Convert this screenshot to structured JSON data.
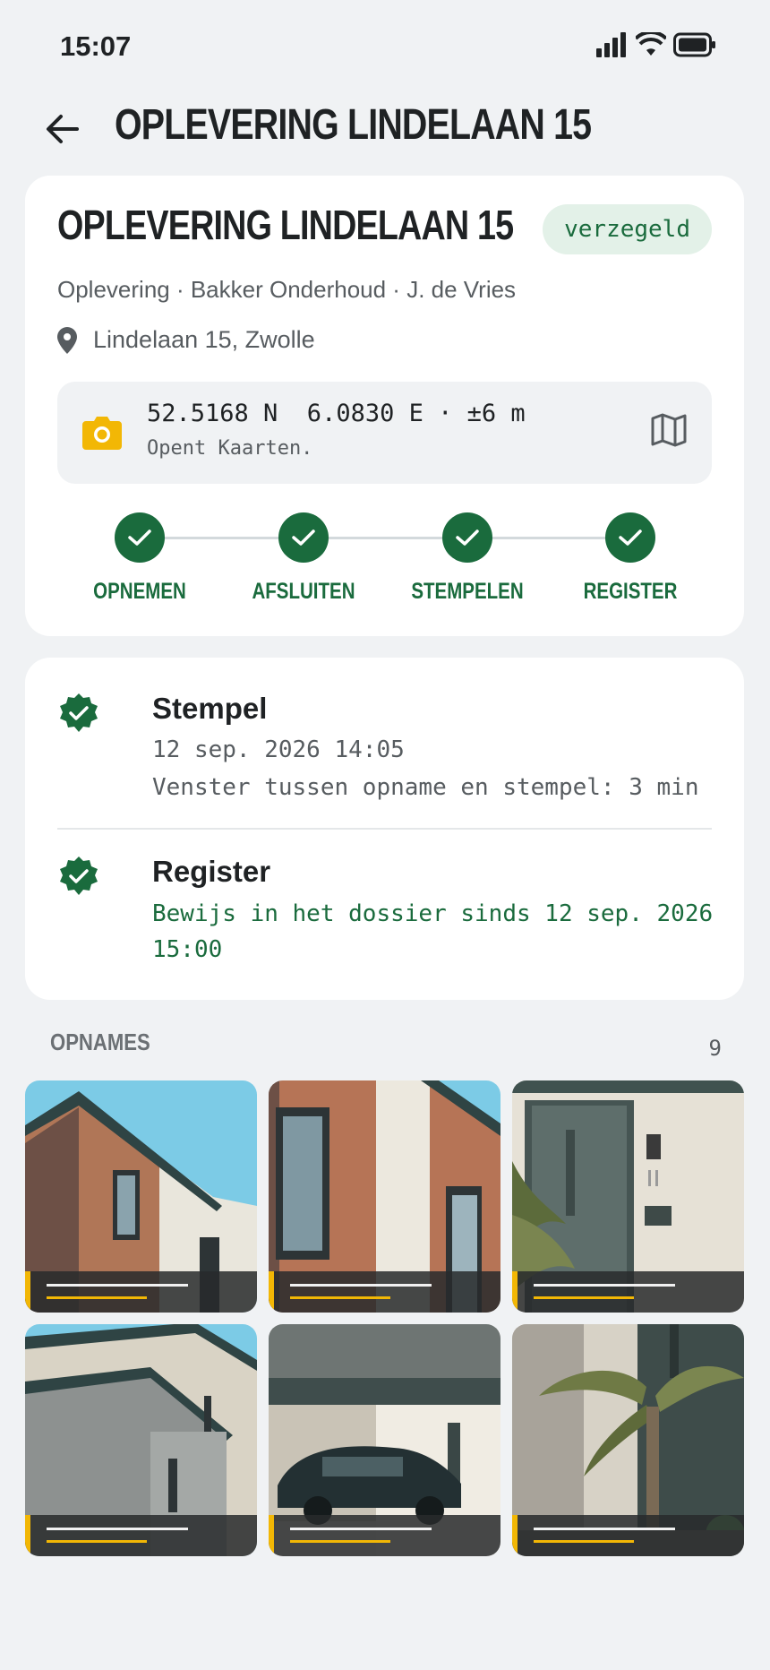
{
  "status": {
    "time": "15:07"
  },
  "app_bar": {
    "title": "OPLEVERING LINDELAAN 15"
  },
  "header": {
    "title": "OPLEVERING LINDELAAN 15",
    "badge": "verzegeld",
    "meta": "Oplevering · Bakker Onderhoud · J. de Vries",
    "address": "Lindelaan 15, Zwolle"
  },
  "geo": {
    "coords": "52.5168 N  6.0830 E · ±6 m",
    "hint": "Opent Kaarten."
  },
  "steps": [
    {
      "label": "OPNEMEN"
    },
    {
      "label": "AFSLUITEN"
    },
    {
      "label": "STEMPELEN"
    },
    {
      "label": "REGISTER"
    }
  ],
  "timeline": [
    {
      "title": "Stempel",
      "line1": "12 sep. 2026 14:05",
      "line2": "Venster tussen opname en stempel: 3 min"
    },
    {
      "title": "Register",
      "line1": "Bewijs in het dossier sinds 12 sep. 2026 15:00"
    }
  ],
  "photos": {
    "title": "OPNAMES",
    "count": "9"
  },
  "colors": {
    "accent": "#1a6b3d",
    "highlight": "#f2b705",
    "background": "#f0f2f4"
  }
}
